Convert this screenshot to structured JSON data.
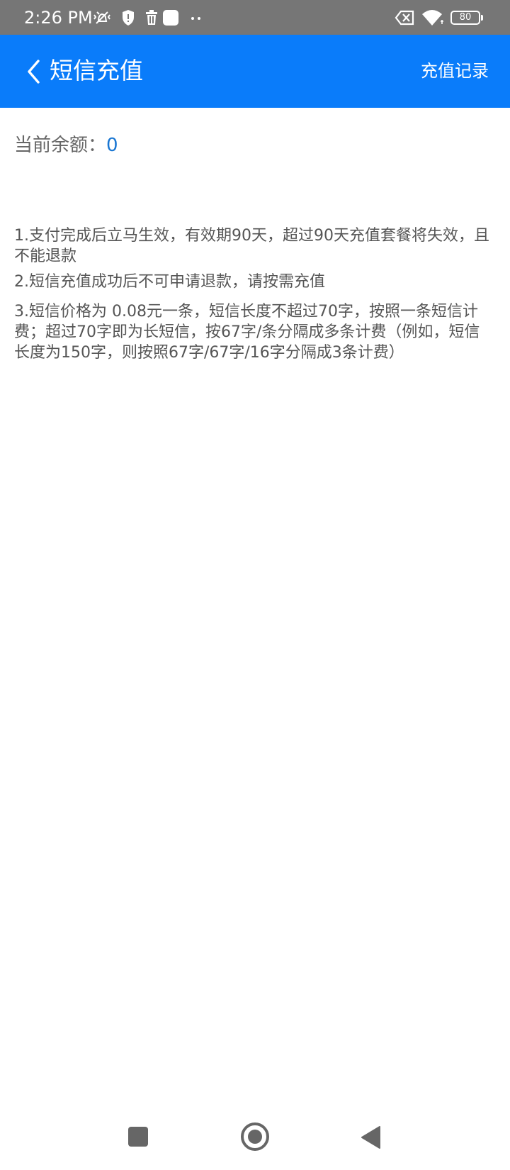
{
  "status_bar": {
    "time": "2:26 PM",
    "battery": "80",
    "left_icons": [
      "mute-vibrate-icon",
      "shield-icon",
      "trash-icon",
      "app-square-icon",
      "more-dots-icon"
    ],
    "right_icons": [
      "no-sim-icon",
      "wifi-icon",
      "battery-icon"
    ]
  },
  "app_bar": {
    "title": "短信充值",
    "action_label": "充值记录",
    "background": "#0A7CFA",
    "back_icon": "chevron-left-icon"
  },
  "balance": {
    "label": "当前余额：",
    "value": "0",
    "value_color": "#1976D2"
  },
  "notes": [
    "1.支付完成后立马生效，有效期90天，超过90天充值套餐将失效，且不能退款",
    "2.短信充值成功后不可申请退款，请按需充值",
    "3.短信价格为 0.08元一条，短信长度不超过70字，按照一条短信计费；超过70字即为长短信，按67字/条分隔成多条计费（例如，短信长度为150字，则按照67字/67字/16字分隔成3条计费）"
  ],
  "nav_bar": {
    "icons": [
      "recent-apps-icon",
      "home-icon",
      "back-triangle-icon"
    ]
  }
}
